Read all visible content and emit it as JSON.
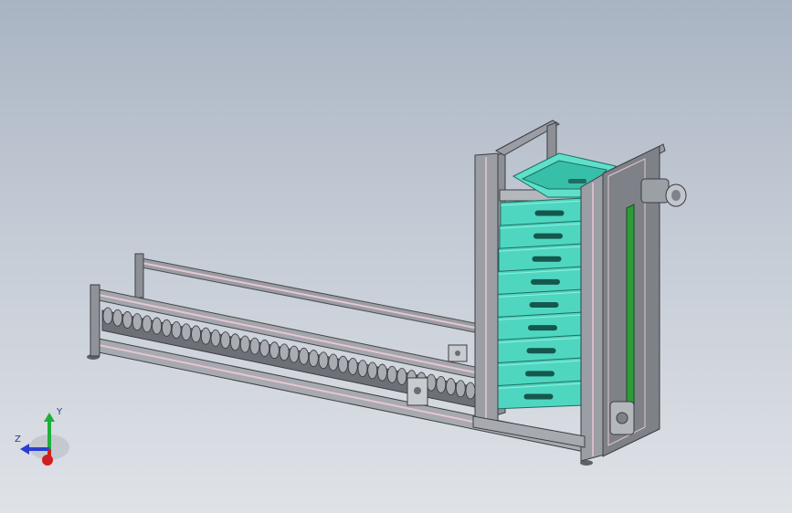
{
  "viewport": {
    "background_top": "#a9b4c3",
    "background_bottom": "#dfe2e7"
  },
  "model": {
    "frame_color": "#8c8f95",
    "rail_accent_color": "#e7c6d3",
    "crate_color": "#4fd6c0",
    "belt_color": "#2e9b3a",
    "motor_color": "#9aa0a6"
  },
  "triad": {
    "x_label": "",
    "y_label": "Y",
    "z_label": "Z",
    "x_color": "#d11f1f",
    "y_color": "#1fae3b",
    "z_color": "#2a3fd1"
  }
}
